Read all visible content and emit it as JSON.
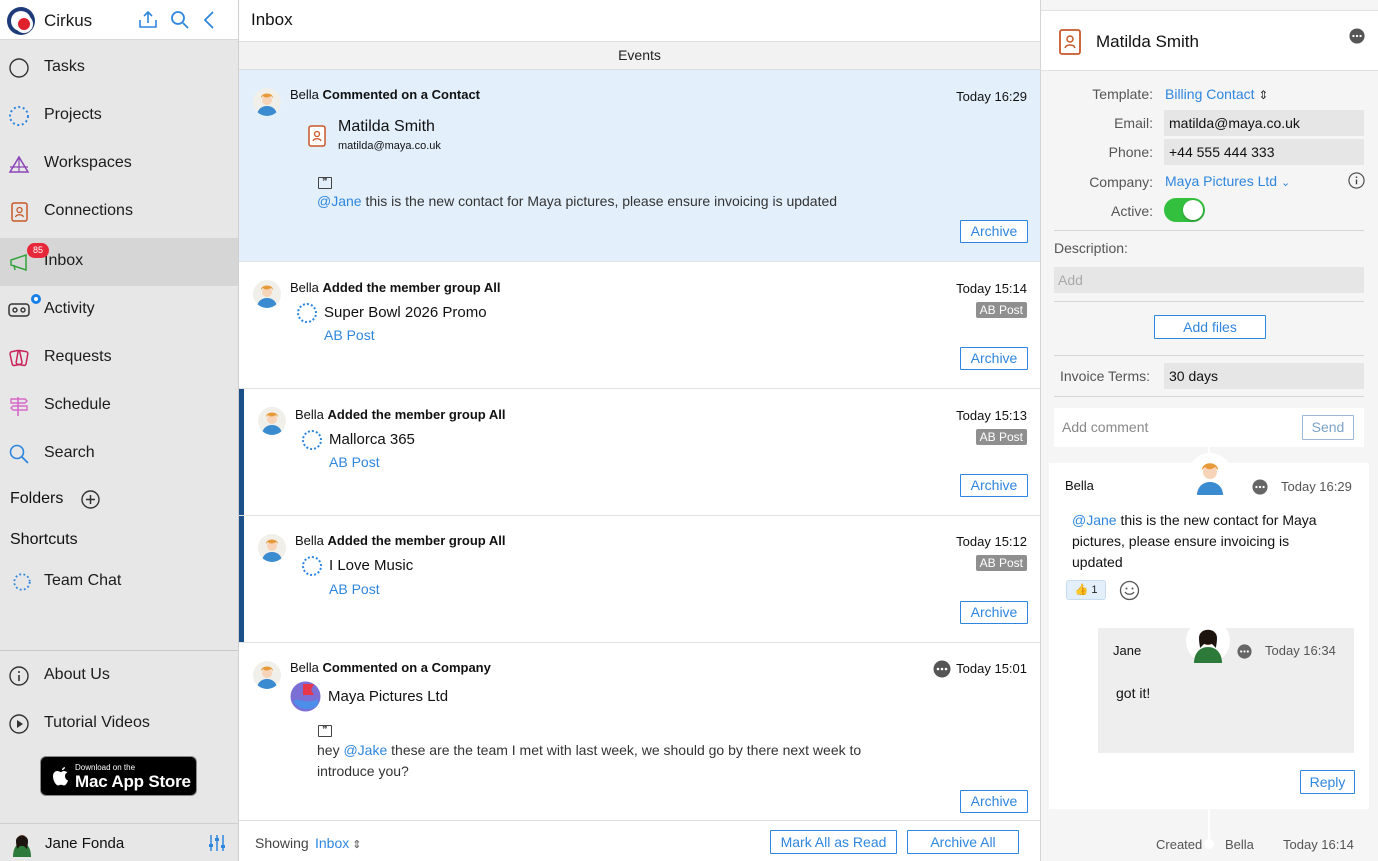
{
  "sidebar": {
    "app_name": "Cirkus",
    "header_icons": [
      "upload-icon",
      "search-icon",
      "collapse-chevron-icon"
    ],
    "nav": [
      {
        "label": "Tasks",
        "icon": "circle-icon"
      },
      {
        "label": "Projects",
        "icon": "dotted-ring-icon"
      },
      {
        "label": "Workspaces",
        "icon": "tent-icon"
      },
      {
        "label": "Connections",
        "icon": "contact-card-icon"
      },
      {
        "label": "Inbox",
        "icon": "megaphone-icon",
        "badge": "85"
      },
      {
        "label": "Activity",
        "icon": "tape-icon"
      },
      {
        "label": "Requests",
        "icon": "cards-icon"
      },
      {
        "label": "Schedule",
        "icon": "signpost-icon"
      },
      {
        "label": "Search",
        "icon": "search-icon"
      }
    ],
    "folders_label": "Folders",
    "shortcuts_label": "Shortcuts",
    "shortcut_items": [
      {
        "label": "Team Chat",
        "icon": "dotted-ring-icon"
      }
    ],
    "bottom_items": [
      {
        "label": "About Us",
        "icon": "info-icon"
      },
      {
        "label": "Tutorial Videos",
        "icon": "play-icon"
      }
    ],
    "appstore": {
      "line1": "Download on the",
      "line2": "Mac App Store"
    },
    "user_name": "Jane Fonda"
  },
  "inbox": {
    "title": "Inbox",
    "section": "Events",
    "cards": [
      {
        "who": "Bella",
        "action": "Commented on a Contact",
        "time": "Today 16:29",
        "contact_name": "Matilda Smith",
        "contact_email": "matilda@maya.co.uk",
        "mention": "@Jane",
        "message": " this is the new contact for Maya pictures, please ensure invoicing is updated",
        "archive": "Archive"
      },
      {
        "who": "Bella",
        "action": "Added the member group All",
        "time": "Today 15:14",
        "tag": "AB Post",
        "project": "Super Bowl 2026 Promo",
        "link": "AB Post",
        "archive": "Archive"
      },
      {
        "who": "Bella",
        "action": "Added the member group All",
        "time": "Today 15:13",
        "tag": "AB Post",
        "project": "Mallorca 365",
        "link": "AB Post",
        "archive": "Archive"
      },
      {
        "who": "Bella",
        "action": "Added the member group All",
        "time": "Today 15:12",
        "tag": "AB Post",
        "project": "I Love Music",
        "link": "AB Post",
        "archive": "Archive"
      },
      {
        "who": "Bella",
        "action": "Commented on a Company",
        "time": "Today 15:01",
        "company": "Maya Pictures Ltd",
        "msg_pre": "hey ",
        "mention": "@Jake",
        "msg_post": " these are the team I met with last week, we should go by there next week to introduce you?",
        "archive": "Archive"
      }
    ],
    "footer": {
      "showing": "Showing",
      "filter": "Inbox",
      "mark_all": "Mark All as Read",
      "archive_all": "Archive All"
    }
  },
  "detail": {
    "name": "Matilda Smith",
    "template_label": "Template:",
    "template_value": "Billing Contact",
    "email_label": "Email:",
    "email_value": "matilda@maya.co.uk",
    "phone_label": "Phone:",
    "phone_value": "+44 555 444 333",
    "company_label": "Company:",
    "company_value": "Maya Pictures Ltd",
    "active_label": "Active:",
    "active": true,
    "description_label": "Description:",
    "description_placeholder": "Add",
    "add_files": "Add files",
    "invoice_label": "Invoice Terms:",
    "invoice_value": "30 days",
    "comment_placeholder": "Add comment",
    "send": "Send",
    "comment": {
      "author": "Bella",
      "time": "Today 16:29",
      "mention": "@Jane",
      "text": " this is the new contact for Maya pictures, please ensure invoicing is updated",
      "reaction": "👍 1"
    },
    "reply": {
      "author": "Jane",
      "time": "Today 16:34",
      "text": "got it!"
    },
    "reply_button": "Reply",
    "created": {
      "label": "Created",
      "by": "Bella",
      "time": "Today 16:14"
    },
    "accent": "#2f86de",
    "toggle_color": "#34c03f"
  }
}
